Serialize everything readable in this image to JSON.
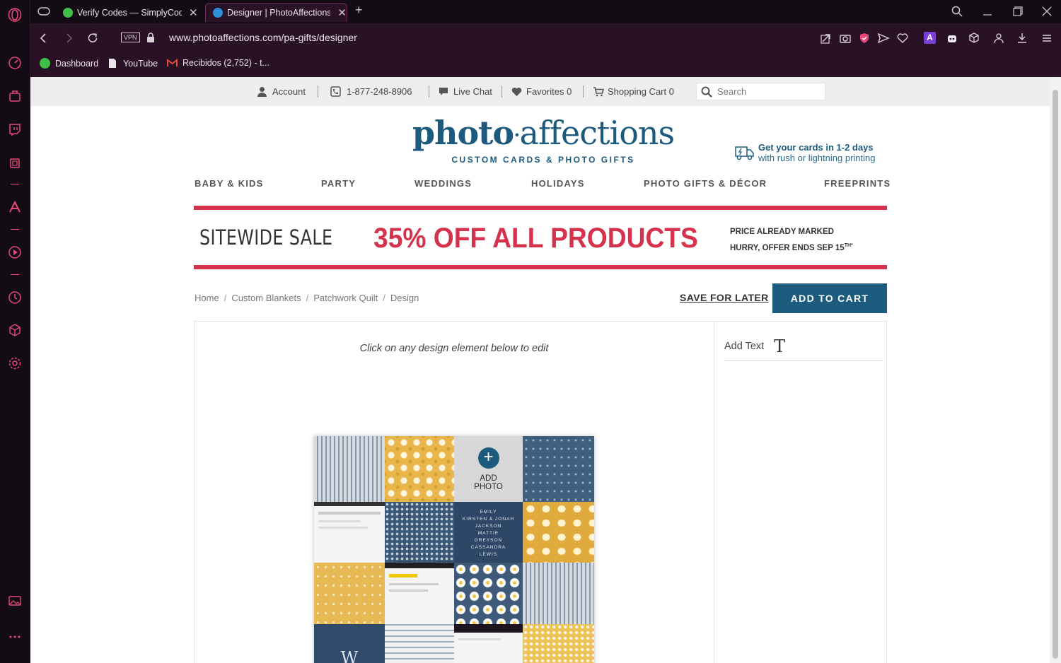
{
  "browser": {
    "tabs": [
      {
        "title": "Verify Codes — SimplyCod",
        "active": false
      },
      {
        "title": "Designer | PhotoAffections",
        "active": true
      }
    ],
    "new_tab": "+",
    "address": {
      "vpn": "VPN",
      "url": "www.photoaffections.com/pa-gifts/designer"
    },
    "bookmarks": [
      {
        "label": "Dashboard"
      },
      {
        "label": "YouTube"
      },
      {
        "label": "Recibidos (2,752) - t..."
      }
    ],
    "colors": {
      "accent": "#e8487a",
      "chrome_bg": "#2a1226"
    }
  },
  "site": {
    "utility": {
      "account": "Account",
      "phone": "1-877-248-8906",
      "chat": "Live Chat",
      "favorites": "Favorites 0",
      "cart": "Shopping Cart 0",
      "search_placeholder": "Search"
    },
    "logo": {
      "part1": "photo",
      "part2": "affections",
      "tagline": "CUSTOM CARDS & PHOTO GIFTS"
    },
    "shipping": {
      "line1": "Get your cards in 1-2 days",
      "line2": "with rush or lightning printing"
    },
    "nav": [
      "BABY & KIDS",
      "PARTY",
      "WEDDINGS",
      "HOLIDAYS",
      "PHOTO GIFTS & DÉCOR",
      "FREEPRINTS"
    ],
    "banner": {
      "left": "SITEWIDE SALE",
      "mid": "35% OFF ALL PRODUCTS",
      "right1": "PRICE ALREADY MARKED",
      "right2": "HURRY, OFFER ENDS SEP 15",
      "right2_sup": "TH*"
    },
    "breadcrumb": [
      "Home",
      "Custom Blankets",
      "Patchwork Quilt",
      "Design"
    ],
    "save_for_later": "SAVE FOR LATER",
    "add_to_cart": "ADD TO CART",
    "designer": {
      "hint": "Click on any design element below to edit",
      "add_text": "Add Text",
      "add_text_glyph": "T",
      "add_photo": [
        "ADD",
        "PHOTO"
      ],
      "names": [
        "EMILY",
        "KIRSTEN & JONAH",
        "JACKSON",
        "MATTIE",
        "GREYSON",
        "CASSANDRA",
        "LEWIS"
      ],
      "monogram": "W"
    },
    "colors": {
      "brand": "#1d5b7e",
      "sale": "#d5334d"
    }
  }
}
